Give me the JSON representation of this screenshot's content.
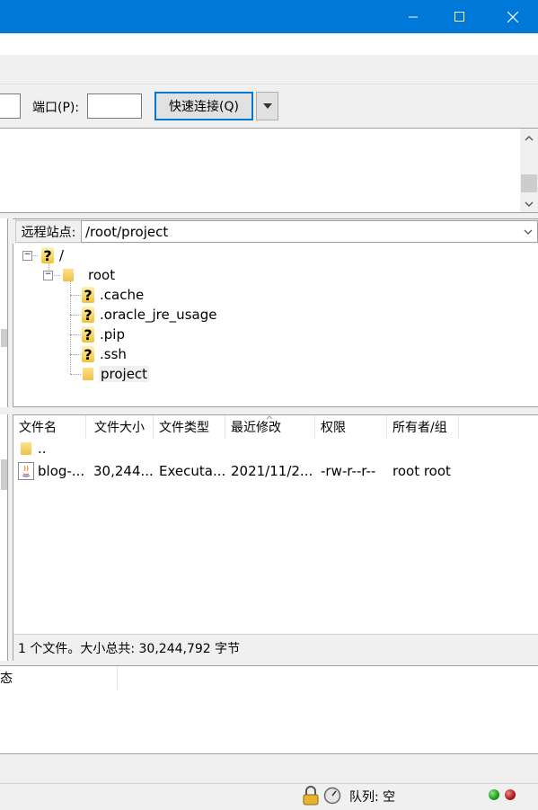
{
  "window": {
    "buttons": [
      "minimize-icon",
      "maximize-icon",
      "close-icon"
    ],
    "accent": "#0078d7"
  },
  "quickconnect": {
    "port_label": "端口(P):",
    "port_value": "",
    "connect_label": "快速连接(Q)"
  },
  "remote": {
    "site_label": "远程站点:",
    "path": "/root/project",
    "tree": [
      {
        "label": "/",
        "icon": "unknown-icon",
        "level": 0
      },
      {
        "label": "root",
        "icon": "folder-icon",
        "level": 1
      },
      {
        "label": ".cache",
        "icon": "unknown-icon",
        "level": 2
      },
      {
        "label": ".oracle_jre_usage",
        "icon": "unknown-icon",
        "level": 2
      },
      {
        "label": ".pip",
        "icon": "unknown-icon",
        "level": 2
      },
      {
        "label": ".ssh",
        "icon": "unknown-icon",
        "level": 2
      },
      {
        "label": "project",
        "icon": "folder-icon",
        "level": 2,
        "selected": true
      }
    ]
  },
  "filelist": {
    "columns": [
      "文件名",
      "文件大小",
      "文件类型",
      "最近修改",
      "权限",
      "所有者/组"
    ],
    "parent_dir": "..",
    "rows": [
      {
        "name": "blog-...",
        "size": "30,244...",
        "type": "Executa...",
        "modified": "2021/11/2...",
        "perms": "-rw-r--r--",
        "owner": "root root",
        "icon": "java-file-icon"
      }
    ],
    "summary": "1 个文件。大小总共: 30,244,792 字节"
  },
  "queue": {
    "column": "态"
  },
  "statusbar": {
    "queue_text": "队列: 空",
    "icons": [
      "lock-icon",
      "speed-limit-icon"
    ],
    "led_colors": [
      "#1a9e1a",
      "#b01818"
    ]
  }
}
